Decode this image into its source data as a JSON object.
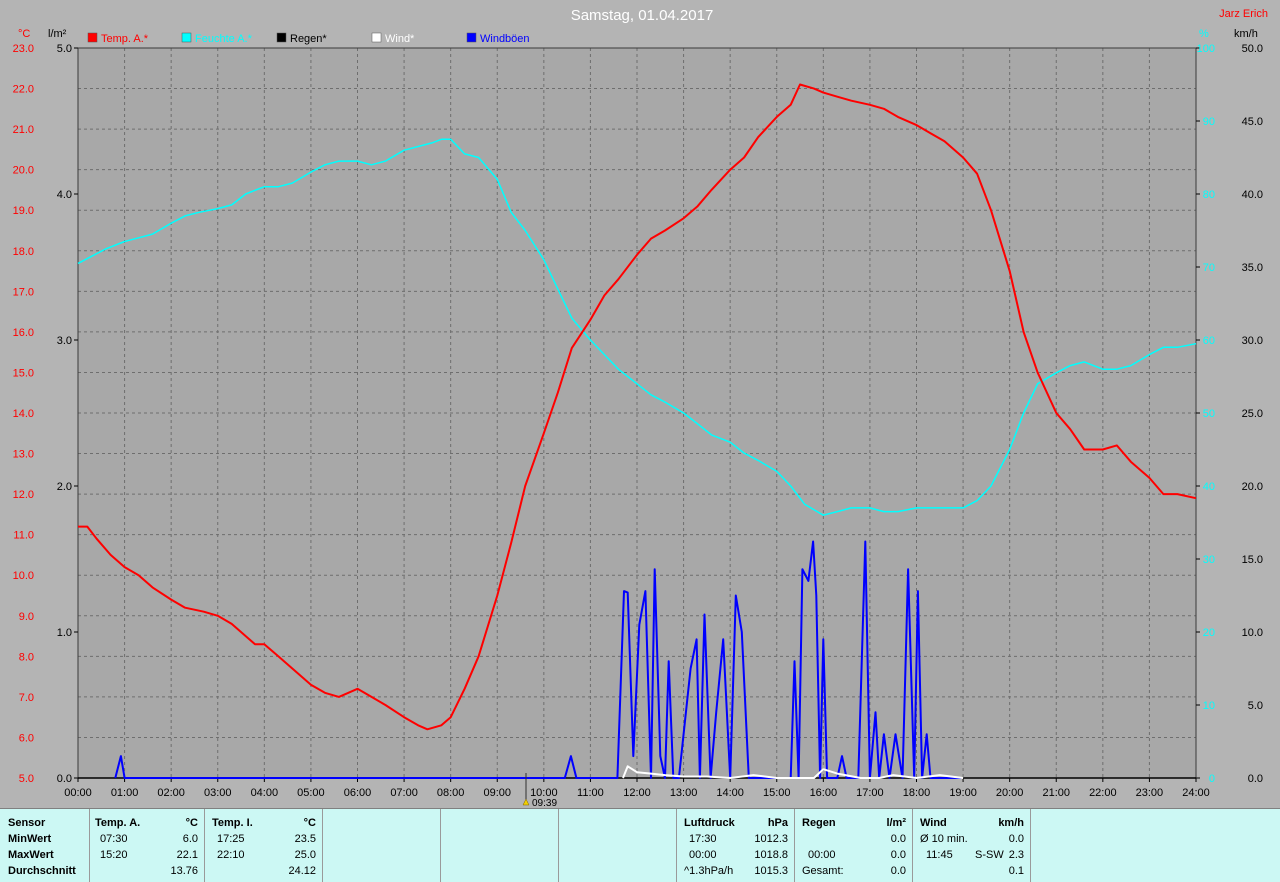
{
  "title": "Samstag, 01.04.2017",
  "author": "Jarz Erich",
  "units": {
    "temp": "°C",
    "rain": "l/m²",
    "humidity": "%",
    "wind": "km/h"
  },
  "legend": [
    {
      "label": "Temp. A.*",
      "color": "#ff0000"
    },
    {
      "label": "Feuchte A.*",
      "color": "#00ffff"
    },
    {
      "label": "Regen*",
      "color": "#000000"
    },
    {
      "label": "Wind*",
      "color": "#ffffff"
    },
    {
      "label": "Windböen",
      "color": "#0000ff"
    }
  ],
  "sun_marker": "09:39",
  "chart_data": {
    "type": "line",
    "x_ticks": [
      "00:00",
      "01:00",
      "02:00",
      "03:00",
      "04:00",
      "05:00",
      "06:00",
      "07:00",
      "08:00",
      "09:00",
      "10:00",
      "11:00",
      "12:00",
      "13:00",
      "14:00",
      "15:00",
      "16:00",
      "17:00",
      "18:00",
      "19:00",
      "20:00",
      "21:00",
      "22:00",
      "23:00",
      "24:00"
    ],
    "axes": {
      "temp": {
        "range": [
          5,
          23
        ],
        "ticks": [
          "5.0",
          "6.0",
          "7.0",
          "8.0",
          "9.0",
          "10.0",
          "11.0",
          "12.0",
          "13.0",
          "14.0",
          "15.0",
          "16.0",
          "17.0",
          "18.0",
          "19.0",
          "20.0",
          "21.0",
          "22.0",
          "23.0"
        ]
      },
      "rain": {
        "range": [
          0,
          5
        ],
        "ticks": [
          "0.0",
          "1.0",
          "2.0",
          "3.0",
          "4.0",
          "5.0"
        ]
      },
      "humidity": {
        "range": [
          0,
          100
        ],
        "ticks": [
          "0",
          "10",
          "20",
          "30",
          "40",
          "50",
          "60",
          "70",
          "80",
          "90",
          "100"
        ]
      },
      "wind": {
        "range": [
          0,
          50
        ],
        "ticks": [
          "0.0",
          "5.0",
          "10.0",
          "15.0",
          "20.0",
          "25.0",
          "30.0",
          "35.0",
          "40.0",
          "45.0",
          "50.0"
        ]
      }
    },
    "series": [
      {
        "name": "Temp. A.*",
        "axis": "temp",
        "color": "#ff0000",
        "x": [
          0,
          0.2,
          0.4,
          0.7,
          1.0,
          1.3,
          1.6,
          2.0,
          2.3,
          2.7,
          3.0,
          3.3,
          3.6,
          3.8,
          4.0,
          4.3,
          4.6,
          5.0,
          5.3,
          5.6,
          6.0,
          6.3,
          6.6,
          7.0,
          7.3,
          7.5,
          7.8,
          8.0,
          8.3,
          8.6,
          9.0,
          9.3,
          9.6,
          10.0,
          10.3,
          10.6,
          11.0,
          11.3,
          11.6,
          12.0,
          12.3,
          12.6,
          13.0,
          13.3,
          13.6,
          14.0,
          14.3,
          14.6,
          15.0,
          15.3,
          15.5,
          15.8,
          16.0,
          16.3,
          16.6,
          17.0,
          17.3,
          17.6,
          18.0,
          18.3,
          18.6,
          19.0,
          19.3,
          19.6,
          20.0,
          20.3,
          20.6,
          21.0,
          21.3,
          21.6,
          22.0,
          22.3,
          22.6,
          23.0,
          23.3,
          23.6,
          24.0
        ],
        "y": [
          11.2,
          11.2,
          10.9,
          10.5,
          10.2,
          10.0,
          9.7,
          9.4,
          9.2,
          9.1,
          9.0,
          8.8,
          8.5,
          8.3,
          8.3,
          8.0,
          7.7,
          7.3,
          7.1,
          7.0,
          7.2,
          7.0,
          6.8,
          6.5,
          6.3,
          6.2,
          6.3,
          6.5,
          7.2,
          8.0,
          9.5,
          10.8,
          12.2,
          13.5,
          14.5,
          15.6,
          16.3,
          16.9,
          17.3,
          17.9,
          18.3,
          18.5,
          18.8,
          19.1,
          19.5,
          20.0,
          20.3,
          20.8,
          21.3,
          21.6,
          22.1,
          22.0,
          21.9,
          21.8,
          21.7,
          21.6,
          21.5,
          21.3,
          21.1,
          20.9,
          20.7,
          20.3,
          19.9,
          19.0,
          17.5,
          16.0,
          15.0,
          14.0,
          13.6,
          13.1,
          13.1,
          13.2,
          12.8,
          12.4,
          12.0,
          12.0,
          11.9
        ]
      },
      {
        "name": "Feuchte A.*",
        "axis": "humidity",
        "color": "#00ffff",
        "x": [
          0,
          0.3,
          0.6,
          1.0,
          1.3,
          1.6,
          2.0,
          2.3,
          2.6,
          3.0,
          3.3,
          3.6,
          4.0,
          4.3,
          4.6,
          5.0,
          5.3,
          5.6,
          6.0,
          6.3,
          6.6,
          7.0,
          7.3,
          7.6,
          7.8,
          8.0,
          8.3,
          8.6,
          9.0,
          9.3,
          9.6,
          10.0,
          10.3,
          10.6,
          11.0,
          11.3,
          11.6,
          12.0,
          12.3,
          12.6,
          13.0,
          13.3,
          13.6,
          14.0,
          14.3,
          14.6,
          15.0,
          15.3,
          15.6,
          16.0,
          16.3,
          16.6,
          17.0,
          17.3,
          17.6,
          18.0,
          18.3,
          18.6,
          19.0,
          19.3,
          19.6,
          20.0,
          20.3,
          20.6,
          21.0,
          21.3,
          21.6,
          22.0,
          22.3,
          22.6,
          23.0,
          23.3,
          23.6,
          24.0
        ],
        "y": [
          70.5,
          71.5,
          72.5,
          73.5,
          74,
          74.5,
          76,
          77,
          77.5,
          78,
          78.5,
          80,
          81,
          81,
          81.5,
          83,
          84,
          84.5,
          84.5,
          84,
          84.5,
          86,
          86.5,
          87,
          87.5,
          87.5,
          85.5,
          85,
          82,
          77.5,
          75,
          71,
          67,
          63,
          60,
          58,
          56,
          54,
          52.5,
          51.5,
          50,
          48.5,
          47,
          46,
          44.5,
          43.5,
          42,
          40,
          37.5,
          36,
          36.5,
          37,
          37,
          36.5,
          36.5,
          37,
          37,
          37,
          37,
          38,
          40,
          45,
          50,
          54,
          55.5,
          56.5,
          57,
          56,
          56,
          56.5,
          58,
          59,
          59,
          59.5
        ]
      },
      {
        "name": "Regen*",
        "axis": "rain",
        "color": "#000000",
        "x": [
          0,
          24
        ],
        "y": [
          0,
          0
        ]
      },
      {
        "name": "Wind*",
        "axis": "wind",
        "color": "#ffffff",
        "x": [
          11.7,
          11.8,
          12.0,
          12.3,
          12.6,
          13.0,
          13.5,
          14.0,
          14.5,
          15.0,
          15.8,
          16.0,
          16.3,
          16.8,
          17.2,
          17.5,
          18.0,
          18.5,
          19.0
        ],
        "y": [
          0,
          0.8,
          0.4,
          0.3,
          0.2,
          0.1,
          0.1,
          0,
          0.2,
          0,
          0,
          0.6,
          0.3,
          0,
          0,
          0.2,
          0,
          0.2,
          0
        ]
      },
      {
        "name": "Windböen",
        "axis": "wind",
        "color": "#0000ff",
        "x": [
          0.8,
          0.92,
          1.0,
          1.1,
          10.45,
          10.58,
          10.7,
          11.58,
          11.72,
          11.8,
          11.92,
          12.05,
          12.18,
          12.3,
          12.38,
          12.5,
          12.6,
          12.68,
          12.78,
          12.9,
          13.15,
          13.28,
          13.35,
          13.45,
          13.58,
          13.7,
          13.85,
          14.0,
          14.12,
          14.25,
          14.4,
          14.52,
          14.65,
          15.3,
          15.38,
          15.47,
          15.55,
          15.68,
          15.78,
          15.85,
          15.93,
          16.0,
          16.08,
          16.15,
          16.3,
          16.4,
          16.5,
          16.6,
          16.75,
          16.9,
          17.0,
          17.12,
          17.2,
          17.3,
          17.42,
          17.55,
          17.7,
          17.82,
          17.95,
          18.03,
          18.12,
          18.22,
          18.3,
          18.4,
          18.48,
          18.55,
          18.6,
          18.68,
          18.78,
          18.88,
          18.95
        ],
        "y": [
          0,
          1.5,
          0,
          0,
          0,
          1.5,
          0,
          0,
          12.8,
          12.7,
          1.5,
          10.5,
          12.8,
          0,
          14.3,
          1.5,
          0,
          8.0,
          0,
          0,
          7.5,
          9.5,
          0,
          11.2,
          0,
          4.5,
          9.5,
          0,
          12.5,
          10.0,
          0,
          0,
          0,
          0,
          8.0,
          0,
          14.3,
          13.5,
          16.2,
          12.5,
          0,
          9.5,
          0,
          0,
          0,
          1.5,
          0,
          0,
          0,
          16.2,
          0,
          4.5,
          0,
          3.0,
          0,
          3.0,
          0,
          14.3,
          0,
          12.8,
          0,
          3.0,
          0,
          0,
          0,
          0,
          0,
          0,
          0,
          0,
          0
        ]
      }
    ]
  },
  "table": {
    "sensor": {
      "header": "Sensor",
      "rows": [
        "MinWert",
        "MaxWert",
        "Durchschnitt"
      ]
    },
    "temp_a": {
      "header": "Temp. A.",
      "unit": "°C",
      "min_time": "07:30",
      "min_val": "6.0",
      "max_time": "15:20",
      "max_val": "22.1",
      "avg": "13.76"
    },
    "temp_i": {
      "header": "Temp. I.",
      "unit": "°C",
      "min_time": "17:25",
      "min_val": "23.5",
      "max_time": "22:10",
      "max_val": "25.0",
      "avg": "24.12"
    },
    "luftdruck": {
      "header": "Luftdruck",
      "unit": "hPa",
      "min_time": "17:30",
      "min_val": "1012.3",
      "max_time": "00:00",
      "max_val": "1018.8",
      "trend": "^1.3hPa/h",
      "avg": "1015.3"
    },
    "regen": {
      "header": "Regen",
      "unit": "l/m²",
      "min_val": "0.0",
      "max_time": "00:00",
      "max_val": "0.0",
      "total_label": "Gesamt:",
      "total": "0.0"
    },
    "wind": {
      "header": "Wind",
      "unit": "km/h",
      "avg_label": "Ø 10 min.",
      "avg10": "0.0",
      "max_time": "11:45",
      "max_dir": "S-SW",
      "max_val": "2.3",
      "avg": "0.1"
    }
  }
}
